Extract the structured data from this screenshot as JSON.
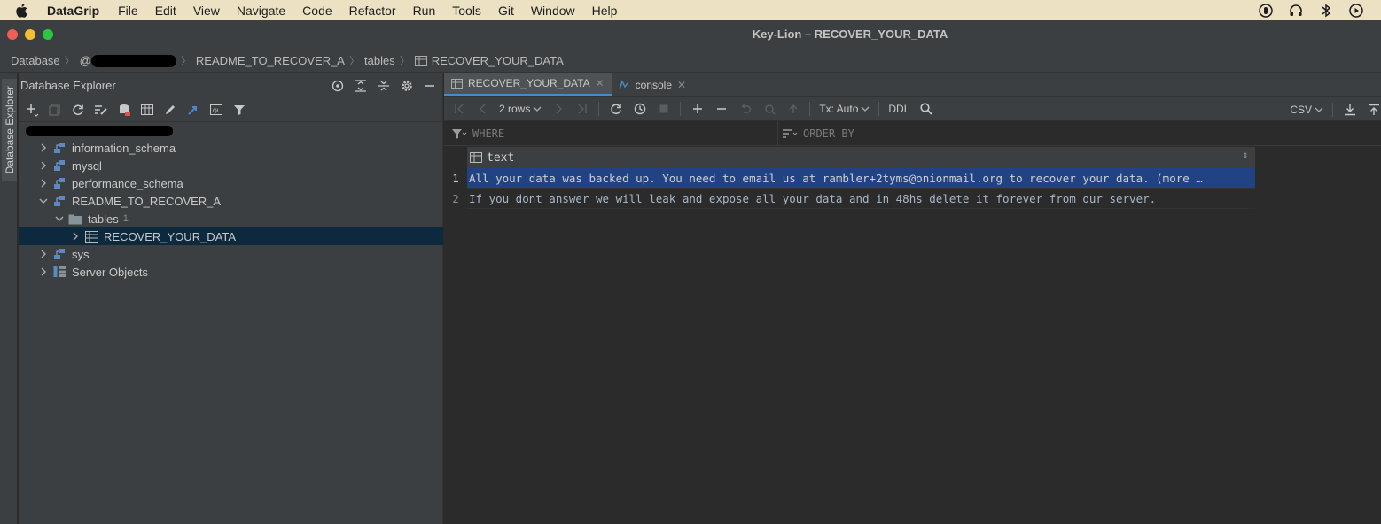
{
  "menubar": {
    "app_name": "DataGrip",
    "items": [
      "File",
      "Edit",
      "View",
      "Navigate",
      "Code",
      "Refactor",
      "Run",
      "Tools",
      "Git",
      "Window",
      "Help"
    ]
  },
  "window": {
    "title": "Key-Lion – RECOVER_YOUR_DATA"
  },
  "breadcrumbs": {
    "root": "Database",
    "host_prefix": "@",
    "schema": "README_TO_RECOVER_A",
    "folder": "tables",
    "table": "RECOVER_YOUR_DATA"
  },
  "sidebar": {
    "vertical_tab": "Database Explorer",
    "title": "Database Explorer",
    "tree": [
      {
        "label": "information_schema",
        "level": 1,
        "expanded": false,
        "icon": "schema-icon"
      },
      {
        "label": "mysql",
        "level": 1,
        "expanded": false,
        "icon": "schema-icon"
      },
      {
        "label": "performance_schema",
        "level": 1,
        "expanded": false,
        "icon": "schema-icon"
      },
      {
        "label": "README_TO_RECOVER_A",
        "level": 1,
        "expanded": true,
        "icon": "schema-icon"
      },
      {
        "label": "tables",
        "count": "1",
        "level": 2,
        "expanded": true,
        "icon": "folder-icon"
      },
      {
        "label": "RECOVER_YOUR_DATA",
        "level": 3,
        "expanded": false,
        "selected": true,
        "icon": "table-icon"
      },
      {
        "label": "sys",
        "level": 1,
        "expanded": false,
        "icon": "schema-icon"
      },
      {
        "label": "Server Objects",
        "level": 1,
        "expanded": false,
        "icon": "server-objects-icon"
      }
    ]
  },
  "editor": {
    "tabs": [
      {
        "label": "RECOVER_YOUR_DATA",
        "active": true
      },
      {
        "label": "console",
        "active": false
      }
    ],
    "toolbar": {
      "rows_label": "2 rows",
      "tx_label": "Tx: Auto",
      "ddl_label": "DDL",
      "export_format": "CSV"
    },
    "filter": {
      "where_placeholder": "WHERE",
      "orderby_placeholder": "ORDER BY"
    },
    "grid": {
      "column": "text",
      "rows": [
        {
          "num": "1",
          "text": "All your data was backed up. You need to email us at rambler+2tyms@onionmail.org to recover your data. (more …",
          "selected": true
        },
        {
          "num": "2",
          "text": "If you dont answer we will leak and expose all your data and in 48hs delete it forever from our server.",
          "selected": false
        }
      ]
    }
  },
  "colors": {
    "accent_blue": "#4a88c7",
    "selection_blue": "#214283",
    "tree_selection": "#0d293e",
    "menubar_bg": "#ede1c4"
  }
}
